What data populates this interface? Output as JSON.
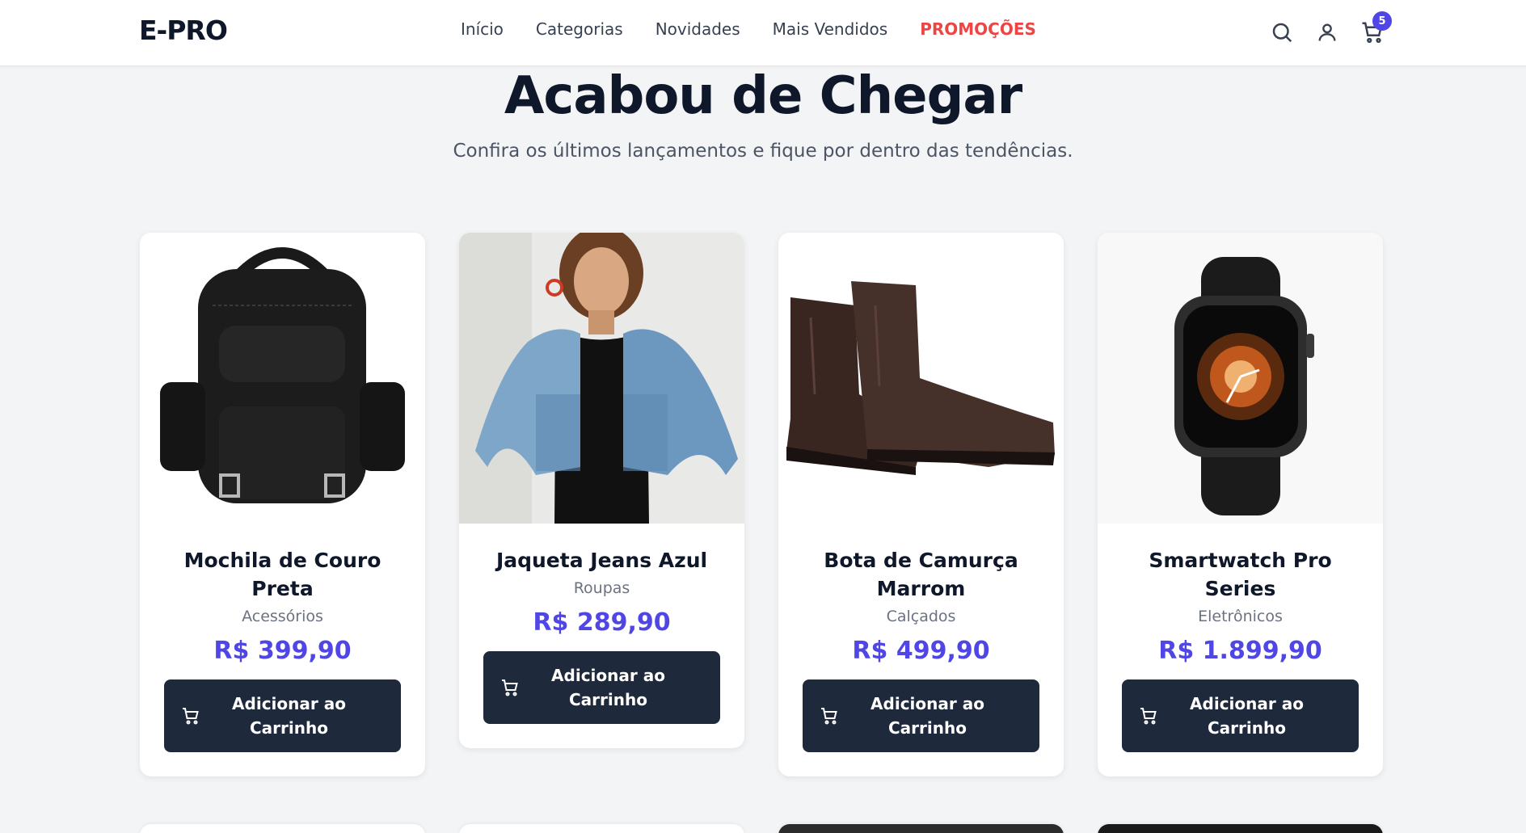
{
  "header": {
    "logo": "E-PRO",
    "nav": [
      {
        "label": "Início"
      },
      {
        "label": "Categorias"
      },
      {
        "label": "Novidades"
      },
      {
        "label": "Mais Vendidos"
      },
      {
        "label": "PROMOÇÕES"
      }
    ],
    "icons": [
      "search-icon",
      "user-icon",
      "cart-icon"
    ],
    "cart_count": "5",
    "colors": {
      "promo": "#ef4444",
      "accent": "#4f46e5",
      "dark": "#1e293b"
    }
  },
  "hero": {
    "title": "Acabou de Chegar",
    "subtitle": "Confira os últimos lançamentos e fique por dentro das tendências."
  },
  "products": [
    {
      "name": "Mochila de Couro Preta",
      "category": "Acessórios",
      "price": "R$ 399,90",
      "button": "Adicionar ao Carrinho",
      "image": "backpack"
    },
    {
      "name": "Jaqueta Jeans Azul",
      "category": "Roupas",
      "price": "R$ 289,90",
      "button": "Adicionar ao Carrinho",
      "image": "denim-jacket"
    },
    {
      "name": "Bota de Camurça Marrom",
      "category": "Calçados",
      "price": "R$ 499,90",
      "button": "Adicionar ao Carrinho",
      "image": "boots"
    },
    {
      "name": "Smartwatch Pro Series",
      "category": "Eletrônicos",
      "price": "R$ 1.899,90",
      "button": "Adicionar ao Carrinho",
      "image": "smartwatch"
    }
  ]
}
